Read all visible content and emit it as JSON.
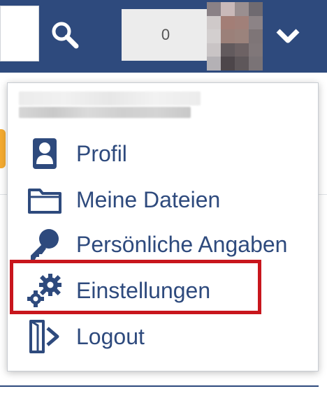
{
  "header": {
    "counter_value": "0",
    "search_icon": "search-icon",
    "caret_icon": "chevron-down-icon"
  },
  "dropdown": {
    "items": [
      {
        "label": "Profil",
        "icon": "user-icon"
      },
      {
        "label": "Meine Dateien",
        "icon": "folder-icon"
      },
      {
        "label": "Persönliche Angaben",
        "icon": "key-icon"
      },
      {
        "label": "Einstellungen",
        "icon": "gears-icon"
      },
      {
        "label": "Logout",
        "icon": "logout-icon"
      }
    ]
  },
  "colors": {
    "header_bg": "#2e4a7d",
    "menu_text": "#2e4a7d",
    "highlight_border": "#c8161d"
  }
}
